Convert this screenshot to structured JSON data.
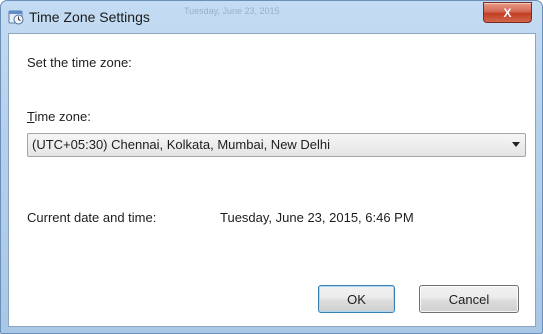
{
  "window": {
    "title": "Time Zone Settings",
    "background_title_text": "Tuesday, June 23, 2015",
    "close_label": "X"
  },
  "content": {
    "heading": "Set the time zone:",
    "time_zone_label_accel": "T",
    "time_zone_label_rest": "ime zone:",
    "time_zone_value": "(UTC+05:30) Chennai, Kolkata, Mumbai, New Delhi",
    "current_label": "Current date and time:",
    "current_value": "Tuesday, June 23, 2015, 6:46 PM"
  },
  "buttons": {
    "ok": "OK",
    "cancel": "Cancel"
  },
  "icons": {
    "title_icon": "time-zone-settings-icon",
    "dropdown_icon": "chevron-down-icon"
  },
  "colors": {
    "title_bar": "#b5d0ec",
    "close_button": "#c33f24",
    "ok_border": "#3c7fb1"
  }
}
